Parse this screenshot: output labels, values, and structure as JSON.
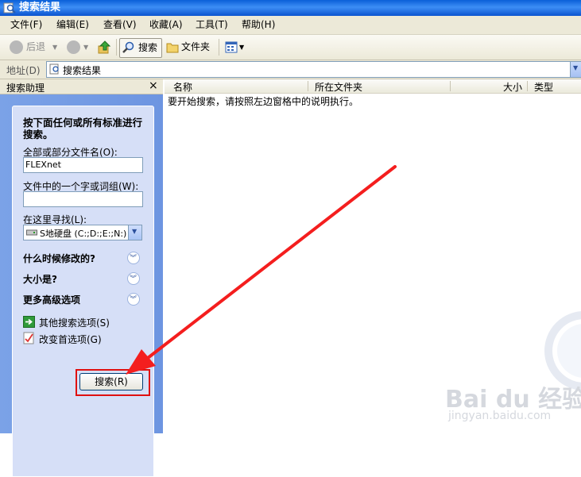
{
  "window": {
    "title": "搜索结果"
  },
  "menu": [
    "文件(F)",
    "编辑(E)",
    "查看(V)",
    "收藏(A)",
    "工具(T)",
    "帮助(H)"
  ],
  "toolbar": {
    "back_label": "后退",
    "search_label": "搜索",
    "folders_label": "文件夹"
  },
  "address": {
    "label": "地址(D)",
    "value": "搜索结果"
  },
  "sidebar": {
    "title": "搜索助理",
    "instructions": "按下面任何或所有标准进行搜索。",
    "filename_label": "全部或部分文件名(O):",
    "filename_value": "FLEXnet",
    "word_label": "文件中的一个字或词组(W):",
    "word_value": "",
    "lookin_label": "在这里寻找(L):",
    "lookin_value": "S地硬盘 (C:;D:;E:;N:)",
    "sections": [
      "什么时候修改的?",
      "大小是?",
      "更多高级选项"
    ],
    "links": [
      "其他搜索选项(S)",
      "改变首选项(G)"
    ],
    "search_button": "搜索(R)"
  },
  "results": {
    "columns": [
      "名称",
      "所在文件夹",
      "大小",
      "类型"
    ],
    "empty_message": "要开始搜索，请按照左边窗格中的说明执行。"
  },
  "watermark": {
    "brand": "Bai du 经验",
    "url": "jingyan.baidu.com"
  },
  "colors": {
    "title_bar": "#0a5fd8",
    "sidebar_bg": "#7ba2e7",
    "panel_bg": "#d6dff7",
    "highlight": "#e01010"
  }
}
